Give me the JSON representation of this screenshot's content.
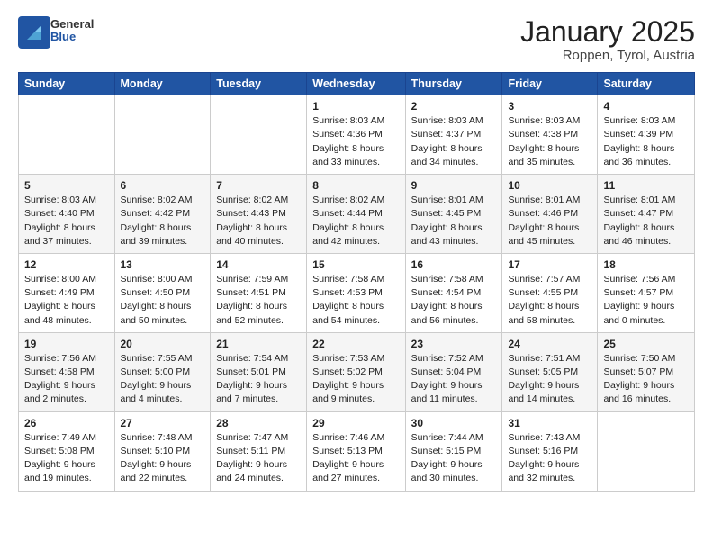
{
  "logo": {
    "general": "General",
    "blue": "Blue"
  },
  "header": {
    "title": "January 2025",
    "subtitle": "Roppen, Tyrol, Austria"
  },
  "days_of_week": [
    "Sunday",
    "Monday",
    "Tuesday",
    "Wednesday",
    "Thursday",
    "Friday",
    "Saturday"
  ],
  "weeks": [
    [
      {
        "day": "",
        "info": ""
      },
      {
        "day": "",
        "info": ""
      },
      {
        "day": "",
        "info": ""
      },
      {
        "day": "1",
        "info": "Sunrise: 8:03 AM\nSunset: 4:36 PM\nDaylight: 8 hours\nand 33 minutes."
      },
      {
        "day": "2",
        "info": "Sunrise: 8:03 AM\nSunset: 4:37 PM\nDaylight: 8 hours\nand 34 minutes."
      },
      {
        "day": "3",
        "info": "Sunrise: 8:03 AM\nSunset: 4:38 PM\nDaylight: 8 hours\nand 35 minutes."
      },
      {
        "day": "4",
        "info": "Sunrise: 8:03 AM\nSunset: 4:39 PM\nDaylight: 8 hours\nand 36 minutes."
      }
    ],
    [
      {
        "day": "5",
        "info": "Sunrise: 8:03 AM\nSunset: 4:40 PM\nDaylight: 8 hours\nand 37 minutes."
      },
      {
        "day": "6",
        "info": "Sunrise: 8:02 AM\nSunset: 4:42 PM\nDaylight: 8 hours\nand 39 minutes."
      },
      {
        "day": "7",
        "info": "Sunrise: 8:02 AM\nSunset: 4:43 PM\nDaylight: 8 hours\nand 40 minutes."
      },
      {
        "day": "8",
        "info": "Sunrise: 8:02 AM\nSunset: 4:44 PM\nDaylight: 8 hours\nand 42 minutes."
      },
      {
        "day": "9",
        "info": "Sunrise: 8:01 AM\nSunset: 4:45 PM\nDaylight: 8 hours\nand 43 minutes."
      },
      {
        "day": "10",
        "info": "Sunrise: 8:01 AM\nSunset: 4:46 PM\nDaylight: 8 hours\nand 45 minutes."
      },
      {
        "day": "11",
        "info": "Sunrise: 8:01 AM\nSunset: 4:47 PM\nDaylight: 8 hours\nand 46 minutes."
      }
    ],
    [
      {
        "day": "12",
        "info": "Sunrise: 8:00 AM\nSunset: 4:49 PM\nDaylight: 8 hours\nand 48 minutes."
      },
      {
        "day": "13",
        "info": "Sunrise: 8:00 AM\nSunset: 4:50 PM\nDaylight: 8 hours\nand 50 minutes."
      },
      {
        "day": "14",
        "info": "Sunrise: 7:59 AM\nSunset: 4:51 PM\nDaylight: 8 hours\nand 52 minutes."
      },
      {
        "day": "15",
        "info": "Sunrise: 7:58 AM\nSunset: 4:53 PM\nDaylight: 8 hours\nand 54 minutes."
      },
      {
        "day": "16",
        "info": "Sunrise: 7:58 AM\nSunset: 4:54 PM\nDaylight: 8 hours\nand 56 minutes."
      },
      {
        "day": "17",
        "info": "Sunrise: 7:57 AM\nSunset: 4:55 PM\nDaylight: 8 hours\nand 58 minutes."
      },
      {
        "day": "18",
        "info": "Sunrise: 7:56 AM\nSunset: 4:57 PM\nDaylight: 9 hours\nand 0 minutes."
      }
    ],
    [
      {
        "day": "19",
        "info": "Sunrise: 7:56 AM\nSunset: 4:58 PM\nDaylight: 9 hours\nand 2 minutes."
      },
      {
        "day": "20",
        "info": "Sunrise: 7:55 AM\nSunset: 5:00 PM\nDaylight: 9 hours\nand 4 minutes."
      },
      {
        "day": "21",
        "info": "Sunrise: 7:54 AM\nSunset: 5:01 PM\nDaylight: 9 hours\nand 7 minutes."
      },
      {
        "day": "22",
        "info": "Sunrise: 7:53 AM\nSunset: 5:02 PM\nDaylight: 9 hours\nand 9 minutes."
      },
      {
        "day": "23",
        "info": "Sunrise: 7:52 AM\nSunset: 5:04 PM\nDaylight: 9 hours\nand 11 minutes."
      },
      {
        "day": "24",
        "info": "Sunrise: 7:51 AM\nSunset: 5:05 PM\nDaylight: 9 hours\nand 14 minutes."
      },
      {
        "day": "25",
        "info": "Sunrise: 7:50 AM\nSunset: 5:07 PM\nDaylight: 9 hours\nand 16 minutes."
      }
    ],
    [
      {
        "day": "26",
        "info": "Sunrise: 7:49 AM\nSunset: 5:08 PM\nDaylight: 9 hours\nand 19 minutes."
      },
      {
        "day": "27",
        "info": "Sunrise: 7:48 AM\nSunset: 5:10 PM\nDaylight: 9 hours\nand 22 minutes."
      },
      {
        "day": "28",
        "info": "Sunrise: 7:47 AM\nSunset: 5:11 PM\nDaylight: 9 hours\nand 24 minutes."
      },
      {
        "day": "29",
        "info": "Sunrise: 7:46 AM\nSunset: 5:13 PM\nDaylight: 9 hours\nand 27 minutes."
      },
      {
        "day": "30",
        "info": "Sunrise: 7:44 AM\nSunset: 5:15 PM\nDaylight: 9 hours\nand 30 minutes."
      },
      {
        "day": "31",
        "info": "Sunrise: 7:43 AM\nSunset: 5:16 PM\nDaylight: 9 hours\nand 32 minutes."
      },
      {
        "day": "",
        "info": ""
      }
    ]
  ]
}
